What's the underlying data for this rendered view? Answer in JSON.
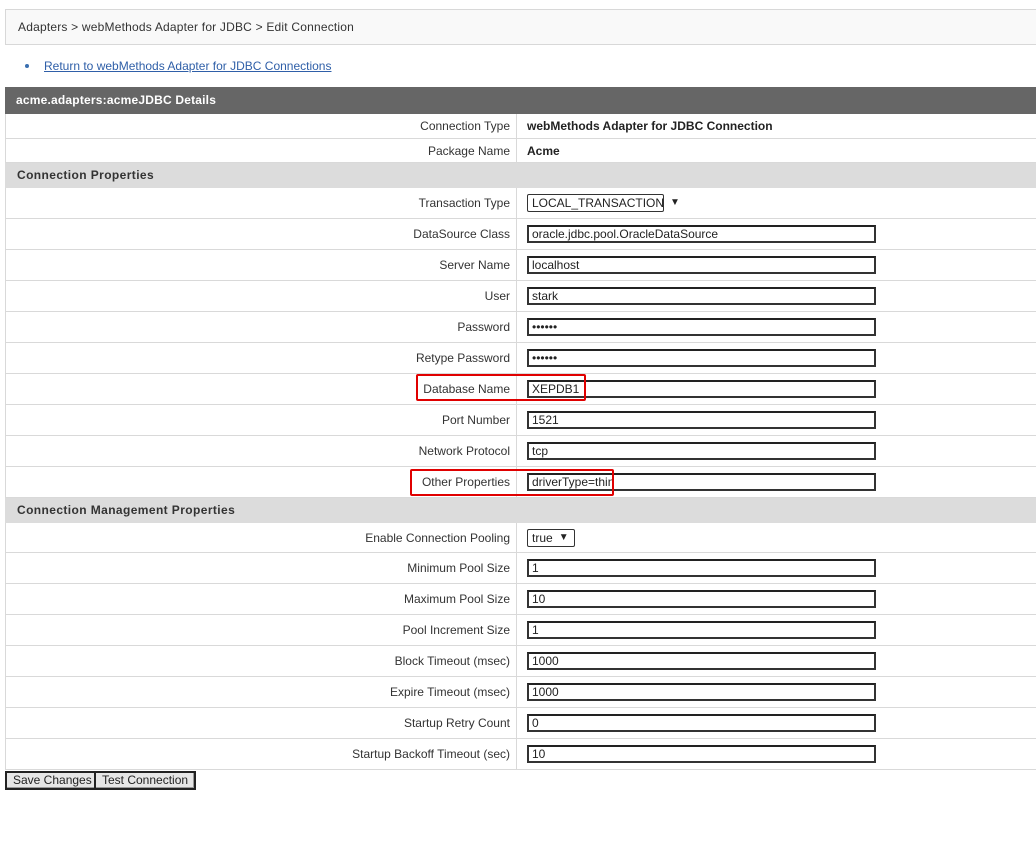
{
  "breadcrumb": "Adapters > webMethods Adapter for JDBC > Edit Connection",
  "return_link": "Return to webMethods Adapter for JDBC Connections",
  "details_title": "acme.adapters:acmeJDBC Details",
  "info": [
    {
      "label": "Connection Type",
      "value": "webMethods Adapter for JDBC Connection"
    },
    {
      "label": "Package Name",
      "value": "Acme"
    }
  ],
  "connection_properties": {
    "title": "Connection Properties",
    "transaction_type": {
      "label": "Transaction Type",
      "value": "LOCAL_TRANSACTION"
    },
    "fields": [
      {
        "label": "DataSource Class",
        "value": "oracle.jdbc.pool.OracleDataSource"
      },
      {
        "label": "Server Name",
        "value": "localhost"
      },
      {
        "label": "User",
        "value": "stark"
      },
      {
        "label": "Password",
        "value": "••••••"
      },
      {
        "label": "Retype Password",
        "value": "••••••"
      },
      {
        "label": "Database Name",
        "value": "XEPDB1"
      },
      {
        "label": "Port Number",
        "value": "1521"
      },
      {
        "label": "Network Protocol",
        "value": "tcp"
      },
      {
        "label": "Other Properties",
        "value": "driverType=thin"
      }
    ]
  },
  "management_properties": {
    "title": "Connection Management Properties",
    "pooling": {
      "label": "Enable Connection Pooling",
      "value": "true"
    },
    "fields": [
      {
        "label": "Minimum Pool Size",
        "value": "1"
      },
      {
        "label": "Maximum Pool Size",
        "value": "10"
      },
      {
        "label": "Pool Increment Size",
        "value": "1"
      },
      {
        "label": "Block Timeout (msec)",
        "value": "1000"
      },
      {
        "label": "Expire Timeout (msec)",
        "value": "1000"
      },
      {
        "label": "Startup Retry Count",
        "value": "0"
      },
      {
        "label": "Startup Backoff Timeout (sec)",
        "value": "10"
      }
    ]
  },
  "buttons": {
    "save": "Save Changes",
    "test": "Test Connection"
  },
  "colors": {
    "title_bar": "#666666",
    "section_bg": "#dcdcdc",
    "highlight": "#e00000",
    "link": "#2f5fa8"
  }
}
